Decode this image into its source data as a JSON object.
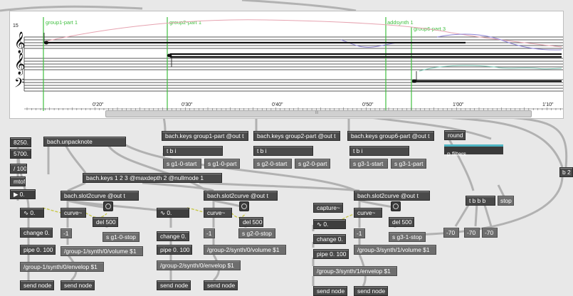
{
  "score": {
    "markers": [
      "group1-part 1",
      "group2-part 1",
      "addsynth 1",
      "group6-part 3"
    ],
    "clef_label": "15",
    "time_labels": [
      "0'20\"",
      "0'30\"",
      "0'40\"",
      "0'50\"",
      "1'00\"",
      "1'10\""
    ],
    "scroll_grip": "III"
  },
  "objects": {
    "num_8250": "8250.",
    "num_5700": "5700.",
    "div100": "/ 100.",
    "mtof": "mtof",
    "num_zero_side": "▶ 0.",
    "unpacknote": "bach.unpacknote",
    "keys_g1": "bach.keys group1-part @out t",
    "keys_g2": "bach.keys group2-part @out t",
    "keys_g6": "bach.keys group6-part @out t",
    "round": "round",
    "pfilters": "p filters",
    "tbi_1": "t b i",
    "tbi_2": "t b i",
    "tbi_3": "t b i",
    "s_g1_start": "s g1-0-start",
    "s_g1_part": "s g1-0-part",
    "s_g2_start": "s g2-0-start",
    "s_g2_part": "s g2-0-part",
    "s_g3_start": "s g3-1-start",
    "s_g3_part": "s g3-1-part",
    "keys_123": "bach.keys 1 2 3 @maxdepth 2 @nullmode 1",
    "slot2curve_1": "bach.slot2curve @out t",
    "slot2curve_2": "bach.slot2curve @out t",
    "slot2curve_3": "bach.slot2curve @out t",
    "b2": "b 2",
    "tbbb": "t b b b",
    "stop": "stop",
    "capture": "capture~",
    "num_wave_1": "∿ 0.",
    "num_wave_2": "∿ 0.",
    "num_wave_3": "∿ 0.",
    "curve_1": "curve~",
    "curve_2": "curve~",
    "curve_3": "curve~",
    "del_1": "del 500",
    "del_2": "del 500",
    "del_3": "del 500",
    "s_g1_stop": "s g1-0-stop",
    "s_g2_stop": "s g2-0-stop",
    "s_g3_stop": "s g3-1-stop",
    "neg1_1": "-1",
    "neg1_2": "-1",
    "neg1_3": "-1",
    "neg70_1": "-70",
    "neg70_2": "-70",
    "neg70_3": "-70",
    "change_1": "change 0.",
    "change_2": "change 0.",
    "change_3": "change 0.",
    "pipe_1": "pipe 0. 100",
    "pipe_2": "pipe 0. 100",
    "pipe_3": "pipe 0. 100",
    "vol_1": "/group-1/synth/0/volume $1",
    "vol_2": "/group-2/synth/0/volume $1",
    "vol_3": "/group-3/synth/1/volume $1",
    "env_1": "/group-1/synth/0/envelop $1",
    "env_2": "/group-2/synth/0/envelop $1",
    "env_3": "/group-3/synth/1/envelop $1",
    "send_1a": "send node",
    "send_1b": "send node",
    "send_2a": "send node",
    "send_2b": "send node",
    "send_3a": "send node",
    "send_3b": "send node"
  },
  "colors": {
    "marker_green": "#3fbf3f",
    "pink_curve": "#e6a3b0",
    "purple_curve": "#8c82d6",
    "teal_curve": "#7cc7b4",
    "patch_cord": "#a8a8a8",
    "signal_cord": "#c8c84a",
    "accent_cyan": "#4fb5c3"
  }
}
